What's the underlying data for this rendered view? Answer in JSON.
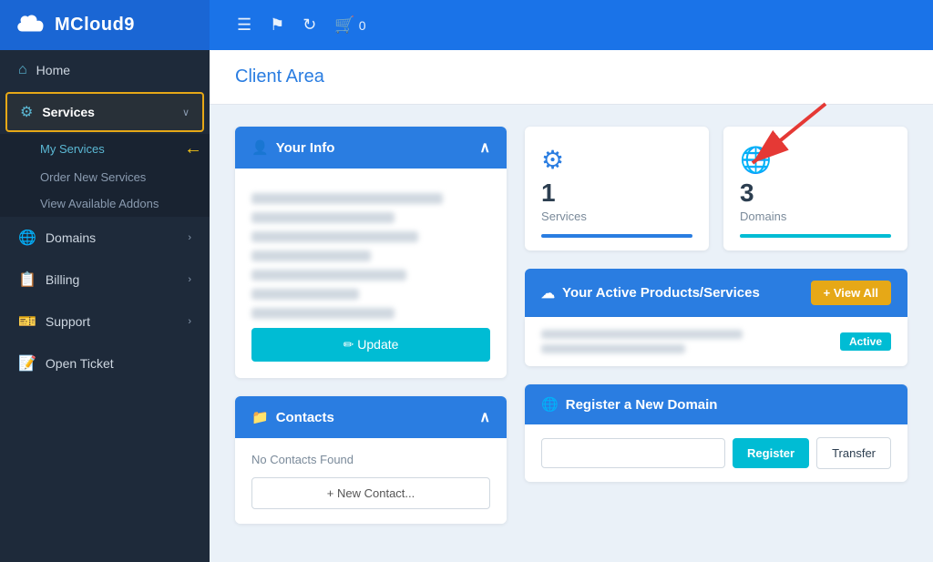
{
  "app": {
    "name": "MCloud9",
    "logo_alt": "MCloud9 logo"
  },
  "topnav": {
    "cart_count": "0",
    "menu_icon": "☰",
    "flag_icon": "⚑",
    "refresh_icon": "↻",
    "cart_icon": "🛒"
  },
  "sidebar": {
    "home_label": "Home",
    "services_label": "Services",
    "my_services_label": "My Services",
    "order_new_label": "Order New Services",
    "view_addons_label": "View Available Addons",
    "domains_label": "Domains",
    "billing_label": "Billing",
    "support_label": "Support",
    "open_ticket_label": "Open Ticket"
  },
  "page": {
    "title": "Client Area"
  },
  "your_info": {
    "header": "Your Info",
    "update_btn": "✏ Update"
  },
  "contacts": {
    "header": "Contacts",
    "no_contacts": "No Contacts Found",
    "new_contact_btn": "+ New Contact..."
  },
  "stats": {
    "services_count": "1",
    "services_label": "Services",
    "domains_count": "3",
    "domains_label": "Domains"
  },
  "active_products": {
    "header": "Your Active Products/Services",
    "view_all_btn": "+ View All",
    "active_badge": "Active"
  },
  "register_domain": {
    "header": "Register a New Domain",
    "input_placeholder": "",
    "register_btn": "Register",
    "transfer_btn": "Transfer"
  }
}
